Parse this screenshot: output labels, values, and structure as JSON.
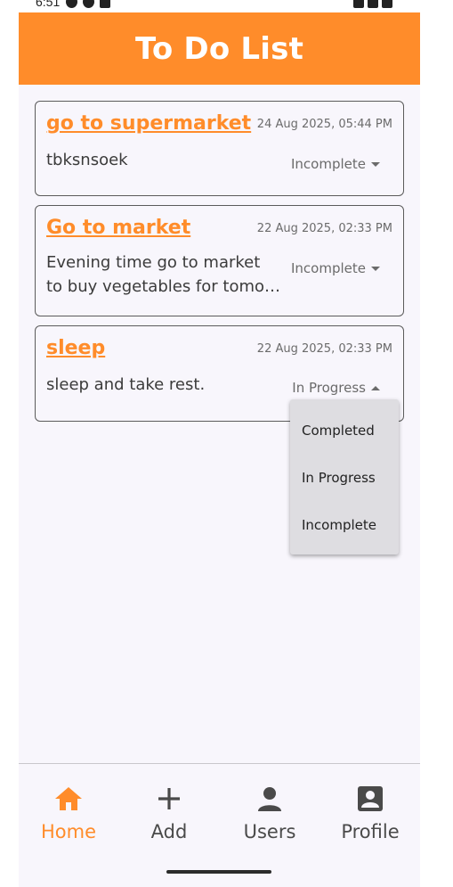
{
  "status_bar": {
    "time": "6:51"
  },
  "app_bar": {
    "title": "To Do List"
  },
  "tasks": [
    {
      "title": "go to supermarket",
      "date": "24 Aug 2025, 05:44 PM",
      "description_lines": [
        "tbksnsoek"
      ],
      "status": "Incomplete",
      "open": false
    },
    {
      "title": "Go to market",
      "date": "22 Aug 2025, 02:33 PM",
      "description_lines": [
        "Evening time go to market",
        "to buy vegetables for tomo…"
      ],
      "status": "Incomplete",
      "open": false
    },
    {
      "title": "sleep",
      "date": "22 Aug 2025, 02:33 PM",
      "description_lines": [
        "sleep and take rest."
      ],
      "status": "In Progress",
      "open": true
    }
  ],
  "status_menu": {
    "options": [
      "Completed",
      "In Progress",
      "Incomplete"
    ]
  },
  "bottom_nav": {
    "items": [
      {
        "label": "Home",
        "icon": "home-icon",
        "active": true
      },
      {
        "label": "Add",
        "icon": "plus-icon",
        "active": false
      },
      {
        "label": "Users",
        "icon": "person-icon",
        "active": false
      },
      {
        "label": "Profile",
        "icon": "account-box-icon",
        "active": false
      }
    ]
  },
  "colors": {
    "accent": "#ff8c2a",
    "background": "#f8f6fc",
    "menu": "#dedde1"
  }
}
